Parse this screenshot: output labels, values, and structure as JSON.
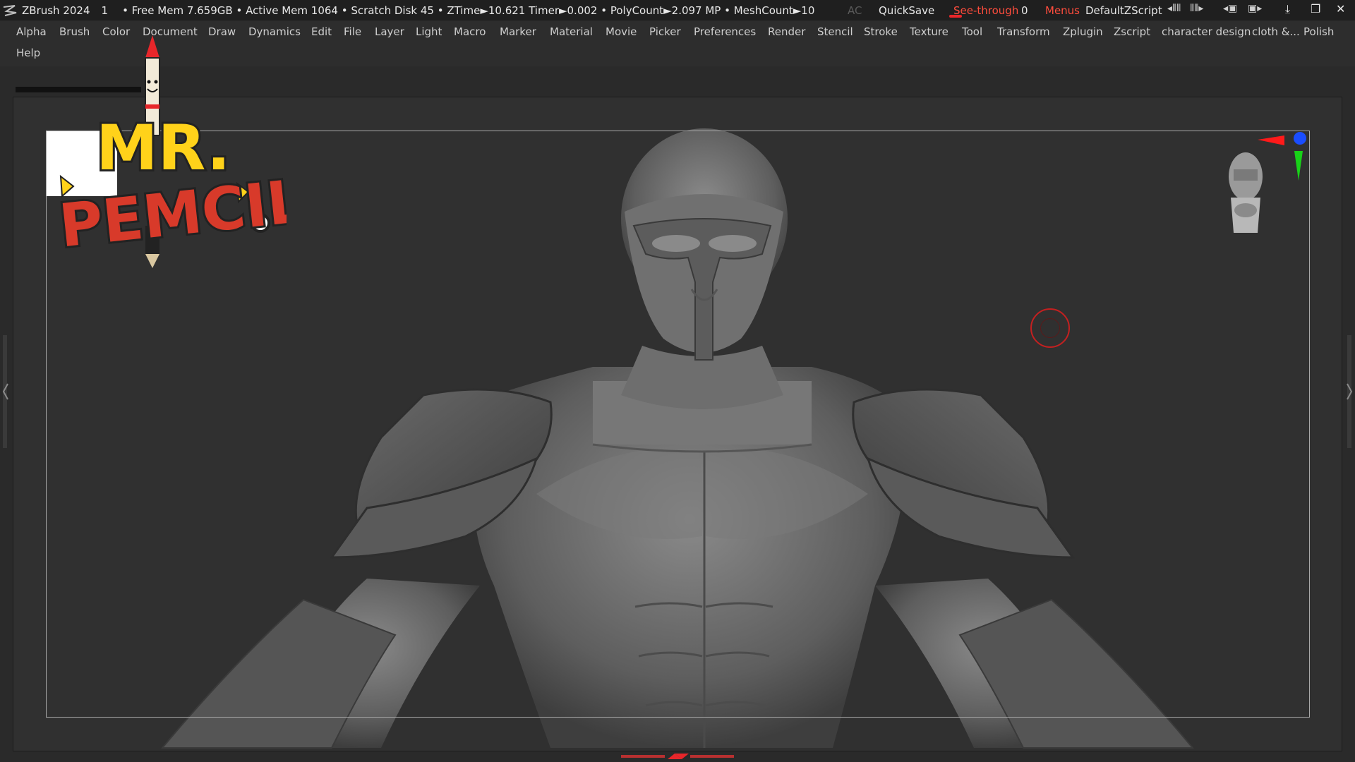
{
  "titlebar": {
    "app_name": "ZBrush 2024",
    "doc_number": "1",
    "stats": "• Free Mem 7.659GB • Active Mem 1064 • Scratch Disk 45 • ZTime►10.621 Timer►0.002 • PolyCount►2.097 MP • MeshCount►10",
    "ac_label": "AC",
    "quicksave_label": "QuickSave",
    "seethrough_label": "See-through",
    "seethrough_value": "0",
    "menus_label": "Menus",
    "script_label": "DefaultZScript"
  },
  "menubar": {
    "items": [
      "Alpha",
      "Brush",
      "Color",
      "Document",
      "Draw",
      "Dynamics",
      "Edit",
      "File",
      "Layer",
      "Light",
      "Macro",
      "Marker",
      "Material",
      "Movie",
      "Picker",
      "Preferences",
      "Render",
      "Stencil",
      "Stroke",
      "Texture",
      "Tool",
      "Transform",
      "Zplugin",
      "Zscript",
      "character design",
      "cloth &...",
      "Polish"
    ],
    "help_label": "Help"
  },
  "logo": {
    "line1": "MR.",
    "line2": "PEMCIL"
  },
  "colors": {
    "accent_red": "#ff4d3d",
    "gizmo_red": "#ff1a1a",
    "gizmo_green": "#18d218",
    "gizmo_blue": "#1a4dff",
    "logo_yellow": "#ffd21a"
  },
  "icons": [
    "zbrush-logo-icon",
    "undo-history-icon",
    "redo-history-icon",
    "layout-left-icon",
    "layout-right-icon",
    "minimize-icon",
    "restore-icon",
    "close-icon",
    "brush-cursor-icon",
    "navigation-gizmo-icon"
  ]
}
